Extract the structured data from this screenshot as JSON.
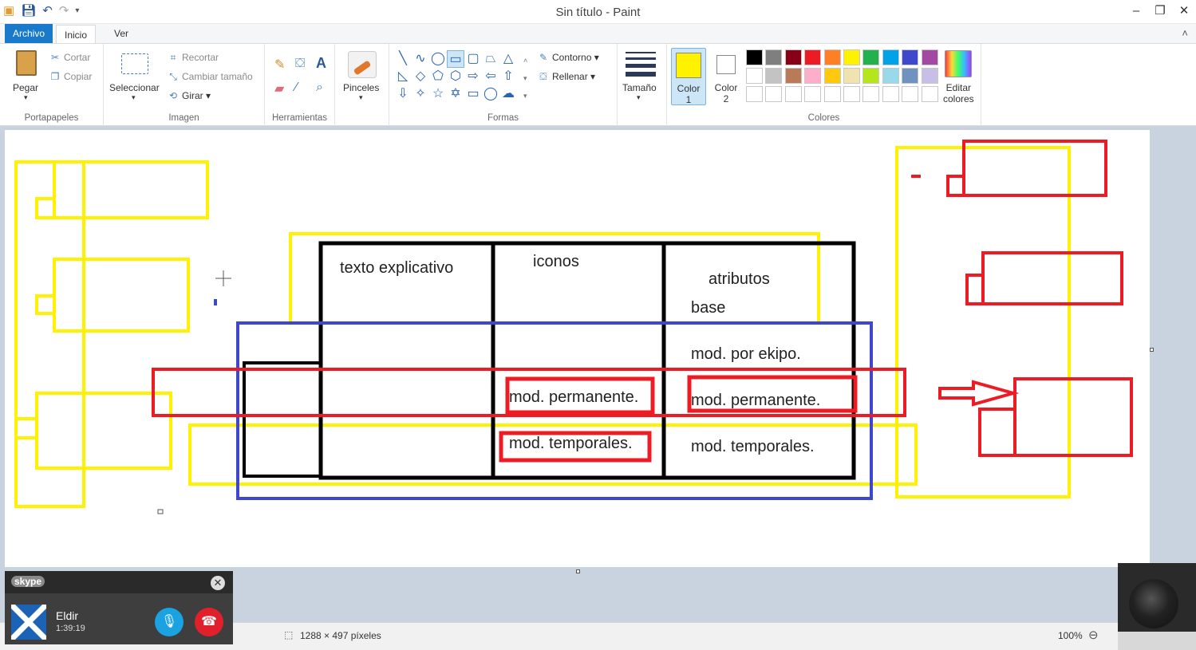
{
  "window": {
    "title": "Sin título - Paint",
    "quick_access": [
      "paint-app-icon",
      "save-icon",
      "undo-icon",
      "redo-icon",
      "customize-icon"
    ],
    "controls": [
      "minimize-icon",
      "restore-icon",
      "close-icon"
    ]
  },
  "tabs": {
    "file": "Archivo",
    "home": "Inicio",
    "view": "Ver"
  },
  "ribbon": {
    "clipboard": {
      "label": "Portapapeles",
      "paste": "Pegar",
      "cut": "Cortar",
      "copy": "Copiar"
    },
    "image": {
      "label": "Imagen",
      "select": "Seleccionar",
      "crop": "Recortar",
      "resize": "Cambiar tamaño",
      "rotate": "Girar"
    },
    "tools": {
      "label": "Herramientas",
      "items": [
        "pencil-icon",
        "fill-icon",
        "text-icon",
        "eraser-icon",
        "color-picker-icon",
        "magnifier-icon"
      ]
    },
    "brushes": {
      "label": "Pinceles"
    },
    "shapes": {
      "label": "Formas",
      "outline": "Contorno",
      "fill": "Rellenar"
    },
    "size": {
      "label": "Tamaño"
    },
    "colors": {
      "label": "Colores",
      "color1": {
        "label": "Color",
        "num": "1",
        "value": "#fff200"
      },
      "color2": {
        "label": "Color",
        "num": "2",
        "value": "#ffffff"
      },
      "edit": "Editar",
      "edit2": "colores",
      "palette": [
        "#000000",
        "#7f7f7f",
        "#880015",
        "#ed1c24",
        "#ff7f27",
        "#fff200",
        "#22b14c",
        "#00a2e8",
        "#3f48cc",
        "#a349a4",
        "#ffffff",
        "#c3c3c3",
        "#b97a57",
        "#ffaec9",
        "#ffc90e",
        "#efe4b0",
        "#b5e61d",
        "#99d9ea",
        "#7092be",
        "#c8bfe7",
        "#ffffff",
        "#ffffff",
        "#ffffff",
        "#ffffff",
        "#ffffff",
        "#ffffff",
        "#ffffff",
        "#ffffff",
        "#ffffff",
        "#ffffff"
      ]
    }
  },
  "canvas_text": {
    "t1": "texto explicativo",
    "t2": "iconos",
    "t3": "atributos",
    "t4": "base",
    "t5": "mod. por ekipo.",
    "t6": "mod. permanente.",
    "t7": "mod. permanente.",
    "t8": "mod. temporales.",
    "t9": "mod. temporales."
  },
  "status": {
    "dimensions": "1288 × 497 píxeles",
    "zoom": "100%"
  },
  "skype": {
    "logo": "skype",
    "name": "Eldir",
    "time": "1:39:19"
  }
}
